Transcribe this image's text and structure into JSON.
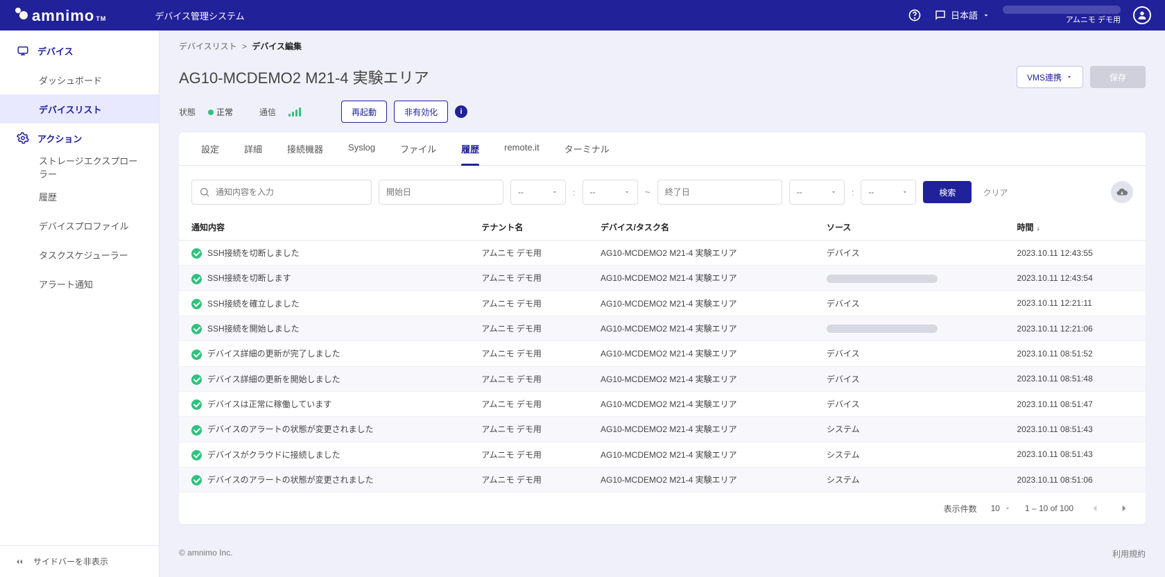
{
  "brand": {
    "name": "amnimo",
    "tm": "TM"
  },
  "app_title": "デバイス管理システム",
  "header": {
    "language_label": "日本語",
    "tenant": "アムニモ デモ用"
  },
  "sidebar": {
    "items": [
      {
        "label": "デバイス",
        "type": "section",
        "icon": "device"
      },
      {
        "label": "ダッシュボード",
        "type": "child"
      },
      {
        "label": "デバイスリスト",
        "type": "child",
        "active": true
      },
      {
        "label": "アクション",
        "type": "section",
        "icon": "gear"
      },
      {
        "label": "ストレージエクスプローラー",
        "type": "child"
      },
      {
        "label": "履歴",
        "type": "child"
      },
      {
        "label": "デバイスプロファイル",
        "type": "child"
      },
      {
        "label": "タスクスケジューラー",
        "type": "child"
      },
      {
        "label": "アラート通知",
        "type": "child"
      }
    ],
    "collapse_label": "サイドバーを非表示"
  },
  "breadcrumb": {
    "parent": "デバイスリスト",
    "sep": ">",
    "current": "デバイス編集"
  },
  "page": {
    "title": "AG10-MCDEMO2 M21-4 実験エリア",
    "vms_button": "VMS連携",
    "save_button": "保存"
  },
  "status": {
    "state_label": "状態",
    "state_value": "正常",
    "comm_label": "通信",
    "restart_button": "再起動",
    "disable_button": "非有効化"
  },
  "tabs": [
    "設定",
    "詳細",
    "接続機器",
    "Syslog",
    "ファイル",
    "履歴",
    "remote.it",
    "ターミナル"
  ],
  "active_tab_index": 5,
  "filters": {
    "search_placeholder": "通知内容を入力",
    "start_date_placeholder": "開始日",
    "end_date_placeholder": "終了日",
    "select_placeholder": "--",
    "search_button": "検索",
    "clear_button": "クリア"
  },
  "table": {
    "columns": [
      "通知内容",
      "テナント名",
      "デバイス/タスク名",
      "ソース",
      "時間"
    ],
    "sort_col_index": 4,
    "rows": [
      {
        "msg": "SSH接続を切断しました",
        "tenant": "アムニモ デモ用",
        "device": "AG10-MCDEMO2 M21-4 実験エリア",
        "source": "デバイス",
        "time": "2023.10.11 12:43:55"
      },
      {
        "msg": "SSH接続を切断します",
        "tenant": "アムニモ デモ用",
        "device": "AG10-MCDEMO2 M21-4 実験エリア",
        "source": "__REDACTED__",
        "time": "2023.10.11 12:43:54"
      },
      {
        "msg": "SSH接続を確立しました",
        "tenant": "アムニモ デモ用",
        "device": "AG10-MCDEMO2 M21-4 実験エリア",
        "source": "デバイス",
        "time": "2023.10.11 12:21:11"
      },
      {
        "msg": "SSH接続を開始しました",
        "tenant": "アムニモ デモ用",
        "device": "AG10-MCDEMO2 M21-4 実験エリア",
        "source": "__REDACTED__",
        "time": "2023.10.11 12:21:06"
      },
      {
        "msg": "デバイス詳細の更新が完了しました",
        "tenant": "アムニモ デモ用",
        "device": "AG10-MCDEMO2 M21-4 実験エリア",
        "source": "デバイス",
        "time": "2023.10.11 08:51:52"
      },
      {
        "msg": "デバイス詳細の更新を開始しました",
        "tenant": "アムニモ デモ用",
        "device": "AG10-MCDEMO2 M21-4 実験エリア",
        "source": "デバイス",
        "time": "2023.10.11 08:51:48"
      },
      {
        "msg": "デバイスは正常に稼働しています",
        "tenant": "アムニモ デモ用",
        "device": "AG10-MCDEMO2 M21-4 実験エリア",
        "source": "デバイス",
        "time": "2023.10.11 08:51:47"
      },
      {
        "msg": "デバイスのアラートの状態が変更されました",
        "tenant": "アムニモ デモ用",
        "device": "AG10-MCDEMO2 M21-4 実験エリア",
        "source": "システム",
        "time": "2023.10.11 08:51:43"
      },
      {
        "msg": "デバイスがクラウドに接続しました",
        "tenant": "アムニモ デモ用",
        "device": "AG10-MCDEMO2 M21-4 実験エリア",
        "source": "システム",
        "time": "2023.10.11 08:51:43"
      },
      {
        "msg": "デバイスのアラートの状態が変更されました",
        "tenant": "アムニモ デモ用",
        "device": "AG10-MCDEMO2 M21-4 実験エリア",
        "source": "システム",
        "time": "2023.10.11 08:51:06"
      }
    ]
  },
  "pager": {
    "rows_label": "表示件数",
    "rows_value": "10",
    "range": "1 – 10 of 100"
  },
  "footer": {
    "copyright": "© amnimo Inc.",
    "terms": "利用規約"
  }
}
